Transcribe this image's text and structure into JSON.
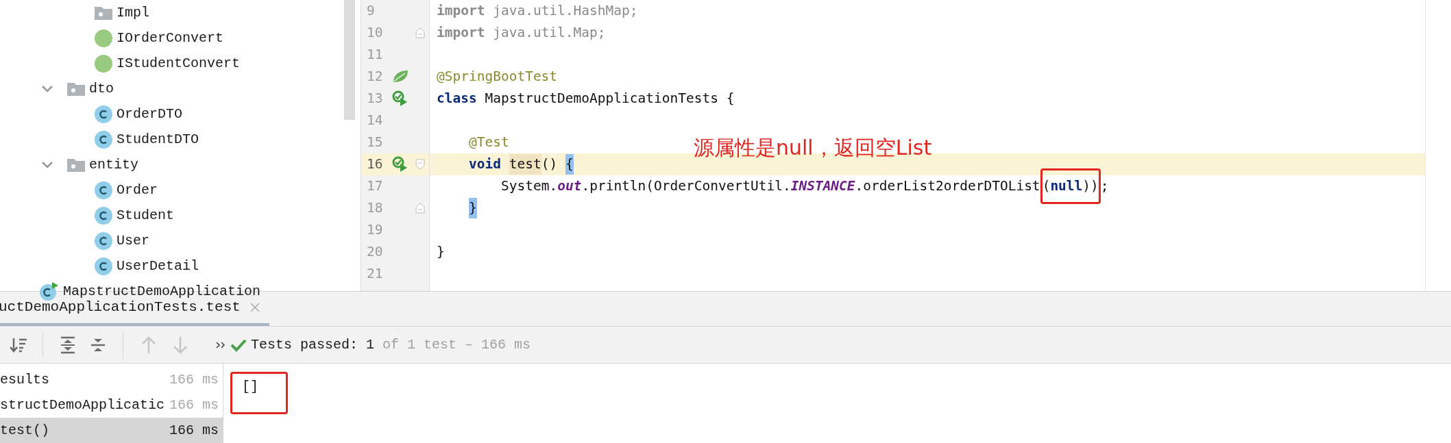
{
  "project_tree": [
    {
      "children": [
        {
          "children": [
            {
              "name": "Impl",
              "kind": "package"
            },
            {
              "name": "IOrderConvert",
              "kind": "interface"
            },
            {
              "name": "IStudentConvert",
              "kind": "interface"
            }
          ]
        },
        {
          "name": "dto",
          "kind": "package",
          "expanded": true,
          "children": [
            {
              "name": "OrderDTO",
              "kind": "class"
            },
            {
              "name": "StudentDTO",
              "kind": "class"
            }
          ]
        },
        {
          "name": "entity",
          "kind": "package",
          "expanded": true,
          "children": [
            {
              "name": "Order",
              "kind": "class"
            },
            {
              "name": "Student",
              "kind": "class"
            },
            {
              "name": "User",
              "kind": "class"
            },
            {
              "name": "UserDetail",
              "kind": "class"
            }
          ]
        }
      ]
    },
    {
      "name": "MapstructDemoApplication",
      "kind": "app_class"
    }
  ],
  "editor": {
    "lines": [
      {
        "number": "9",
        "current": false,
        "tokens": [
          {
            "text": "import",
            "kind": "keyword_unused"
          },
          {
            "text": " java.util.HashMap;",
            "kind": "unused"
          }
        ]
      },
      {
        "number": "10",
        "current": false,
        "fold": {
          "kind": "end"
        },
        "tokens": [
          {
            "text": "import",
            "kind": "keyword_unused"
          },
          {
            "text": " java.util.Map;",
            "kind": "unused"
          }
        ]
      },
      {
        "number": "11",
        "current": false
      },
      {
        "number": "12",
        "current": false,
        "gutter": {
          "kind": "spring"
        },
        "tokens": [
          {
            "text": "@SpringBootTest",
            "kind": "annotation"
          }
        ]
      },
      {
        "number": "13",
        "current": false,
        "gutter": {
          "kind": "run"
        },
        "tokens": [
          {
            "text": "class",
            "kind": "keyword"
          },
          {
            "text": " MapstructDemoApplicationTests {",
            "kind": "plain"
          }
        ]
      },
      {
        "number": "14",
        "current": false
      },
      {
        "number": "15",
        "current": false,
        "indent": {
          "kind": "member"
        },
        "tokens": [
          {
            "text": "@Test",
            "kind": "annotation"
          }
        ]
      },
      {
        "number": "16",
        "current": true,
        "gutter": {
          "kind": "run"
        },
        "fold": {
          "kind": "start"
        },
        "indent": {
          "kind": "member"
        },
        "tokens": [
          {
            "text": "void ",
            "kind": "keyword"
          },
          {
            "text": "test",
            "kind": "highlight"
          },
          {
            "text": "() ",
            "kind": "plain"
          },
          {
            "text": "{",
            "kind": "brace_match"
          }
        ]
      },
      {
        "number": "17",
        "current": false,
        "indent": {
          "kind": "statement"
        },
        "tokens": [
          {
            "text": "System.",
            "kind": "plain"
          },
          {
            "text": "out",
            "kind": "static_field"
          },
          {
            "text": ".println(OrderConvertUtil.",
            "kind": "plain"
          },
          {
            "text": "INSTANCE",
            "kind": "constant"
          },
          {
            "text": ".orderList2orderDTOList",
            "kind": "plain"
          },
          {
            "text": "(",
            "kind": "plain",
            "boxed": true
          },
          {
            "text": "null",
            "kind": "keyword",
            "boxed": true
          },
          {
            "text": "))",
            "kind": "plain",
            "boxed": true
          },
          {
            "text": ";",
            "kind": "plain"
          }
        ]
      },
      {
        "number": "18",
        "current": false,
        "fold": {
          "kind": "end"
        },
        "indent": {
          "kind": "member"
        },
        "tokens": [
          {
            "text": "}",
            "kind": "brace_match"
          }
        ]
      },
      {
        "number": "19",
        "current": false
      },
      {
        "number": "20",
        "current": false,
        "tokens": [
          {
            "text": "}",
            "kind": "plain"
          }
        ]
      },
      {
        "number": "21",
        "current": false
      }
    ],
    "callout": "源属性是null，返回空List"
  },
  "run_panel": {
    "tab": {
      "label": "uctDemoApplicationTests.test",
      "selected": true
    },
    "toolbar": [
      {
        "kind": "sort",
        "disabled": false
      },
      {
        "kind": "separator"
      },
      {
        "kind": "expand_all",
        "disabled": false
      },
      {
        "kind": "collapse_all",
        "disabled": false
      },
      {
        "kind": "separator"
      },
      {
        "kind": "up",
        "disabled": true
      },
      {
        "kind": "down",
        "disabled": true
      },
      {
        "kind": "more",
        "disabled": false
      }
    ],
    "status": {
      "label": "Tests passed:",
      "count": "1",
      "detail": "of 1 test – 166 ms"
    },
    "tests": [
      {
        "name": "esults",
        "time": "166 ms",
        "selected": false
      },
      {
        "name": "structDemoApplicatic",
        "time": "166 ms",
        "selected": false
      },
      {
        "name": "test()",
        "time": "166 ms",
        "selected": true
      }
    ],
    "output": {
      "text": "[]",
      "boxed": true
    }
  }
}
